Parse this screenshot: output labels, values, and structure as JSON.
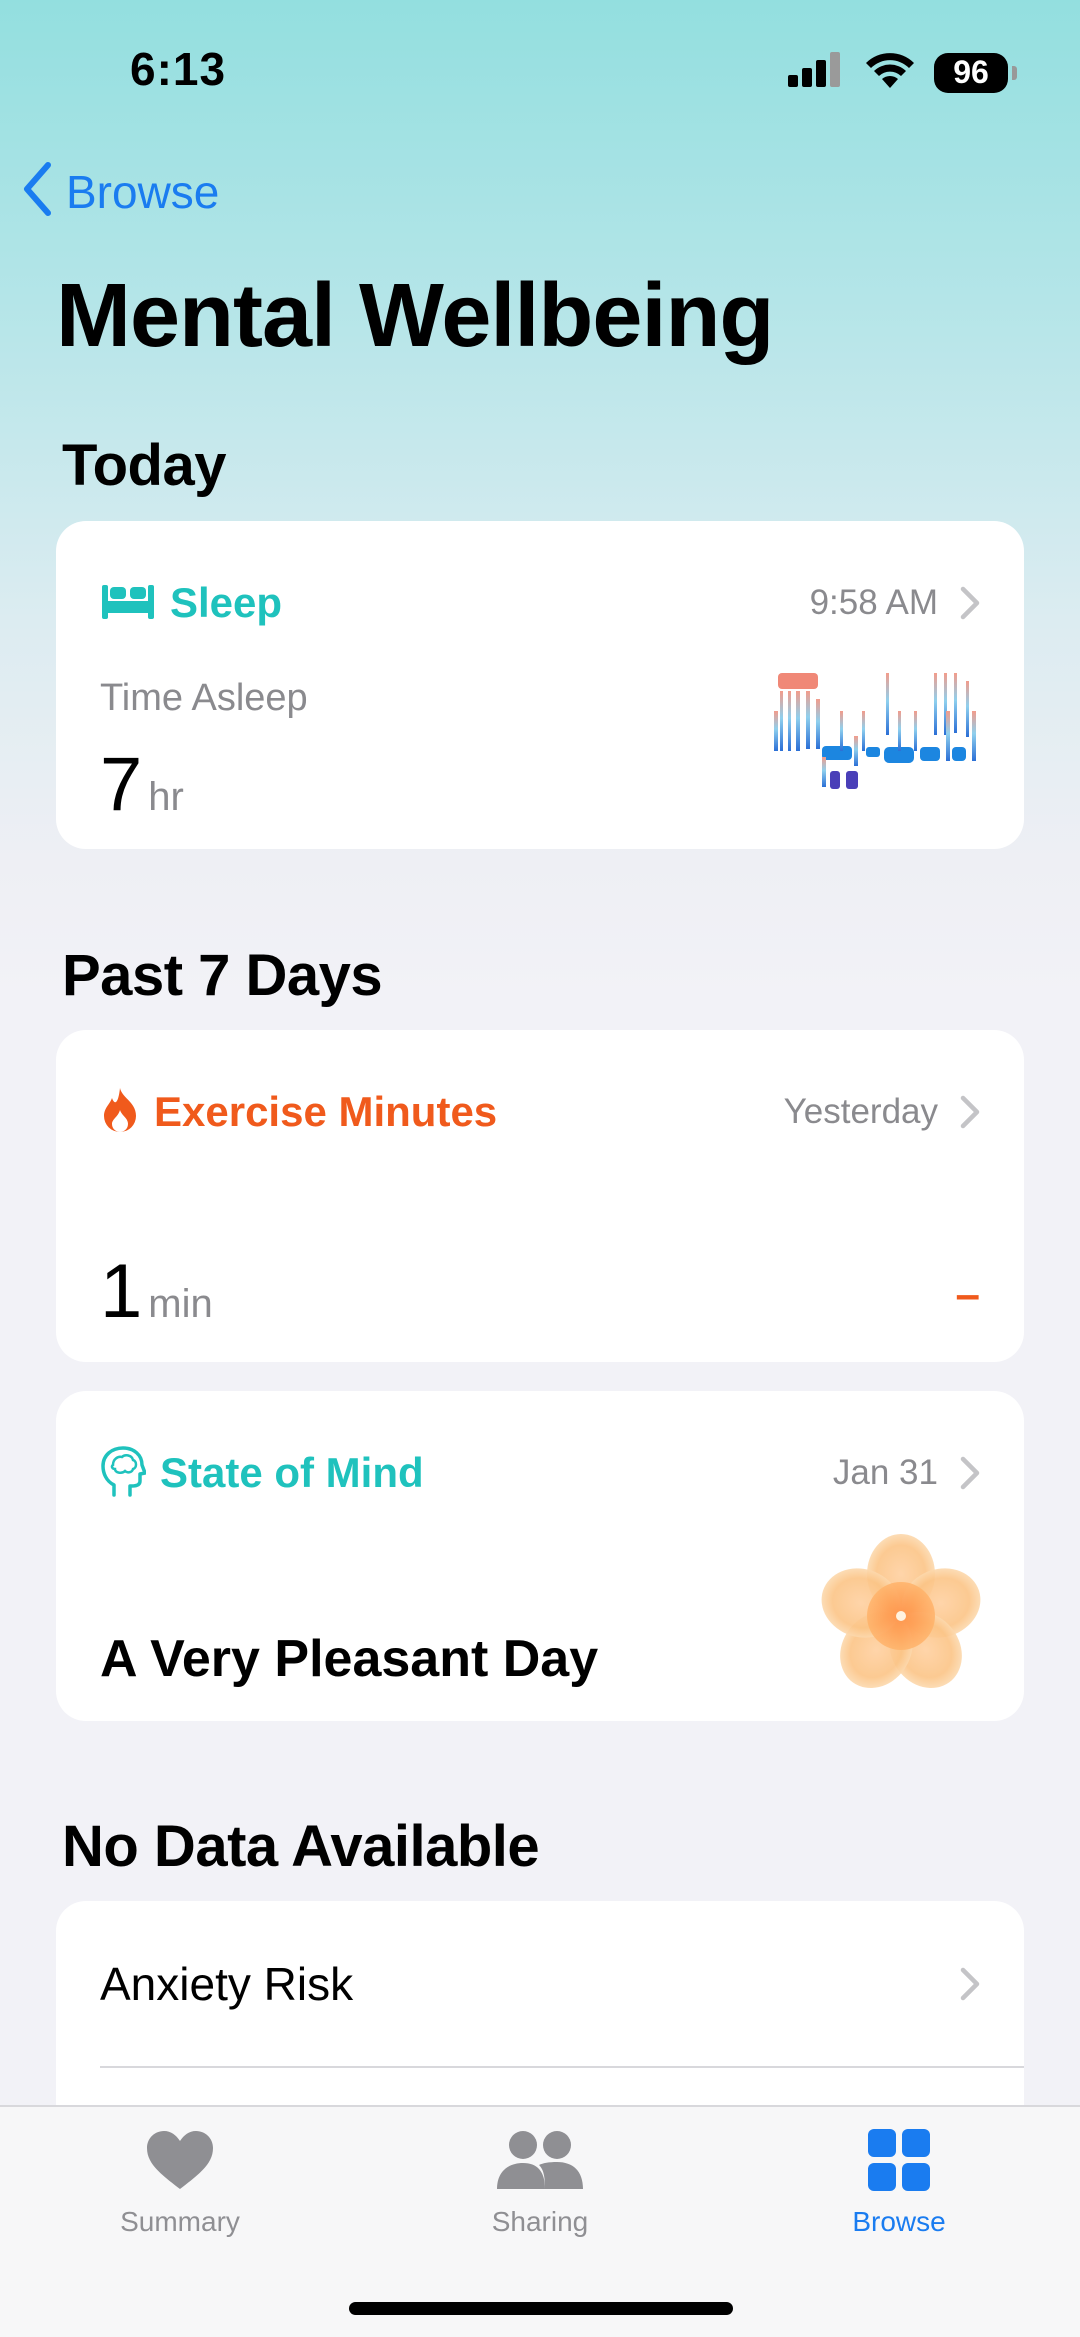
{
  "status": {
    "time": "6:13",
    "battery": "96"
  },
  "nav": {
    "back_label": "Browse"
  },
  "page_title": "Mental Wellbeing",
  "sections": {
    "today": "Today",
    "past7": "Past 7 Days",
    "nodata": "No Data Available"
  },
  "sleep": {
    "title": "Sleep",
    "time": "9:58 AM",
    "label": "Time Asleep",
    "value": "7",
    "unit": "hr",
    "icon": "bed-icon",
    "color": "#1fc2bd"
  },
  "exercise": {
    "title": "Exercise Minutes",
    "time": "Yesterday",
    "value": "1",
    "unit": "min",
    "indicator": "–",
    "icon": "flame-icon",
    "color": "#f05a1c"
  },
  "state_of_mind": {
    "title": "State of Mind",
    "time": "Jan 31",
    "summary": "A Very Pleasant Day",
    "icon": "brain-head-icon",
    "color": "#1fc2bd"
  },
  "no_data_items": [
    {
      "label": "Anxiety Risk"
    }
  ],
  "tabs": [
    {
      "label": "Summary",
      "icon": "heart-icon",
      "active": false
    },
    {
      "label": "Sharing",
      "icon": "people-icon",
      "active": false
    },
    {
      "label": "Browse",
      "icon": "grid-icon",
      "active": true
    }
  ]
}
